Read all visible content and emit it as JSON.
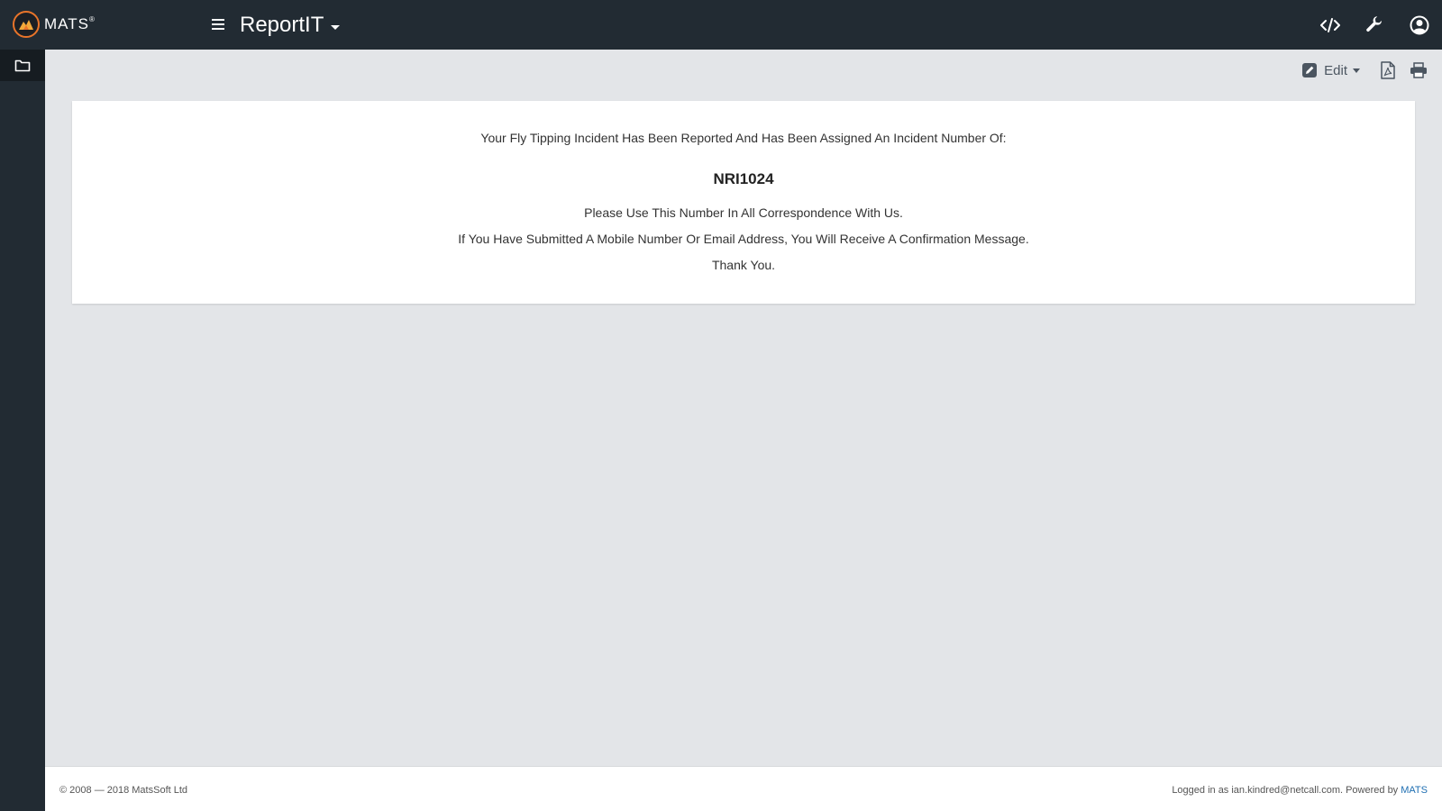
{
  "header": {
    "logo_text": "MATS",
    "logo_superscript": "®",
    "app_title": "ReportIT",
    "icons": [
      "menu-icon",
      "code-icon",
      "wrench-icon",
      "user-circle-icon"
    ]
  },
  "sidebar": {
    "items": [
      {
        "icon": "folder-icon"
      }
    ]
  },
  "toolbar": {
    "edit_label": "Edit",
    "icons": [
      "edit-icon",
      "pdf-icon",
      "print-icon"
    ]
  },
  "content": {
    "line1": "Your Fly Tipping Incident Has Been Reported And Has Been Assigned An Incident Number Of:",
    "incident_number": "NRI1024",
    "line2": "Please Use This Number In All Correspondence With Us.",
    "line3": "If You Have Submitted A Mobile Number Or Email Address, You Will Receive A Confirmation Message.",
    "line4": "Thank You."
  },
  "footer": {
    "copyright": "© 2008 — 2018 MatsSoft Ltd",
    "logged_in": "Logged in as ian.kindred@netcall.com. Powered by ",
    "powered_link": "MATS"
  },
  "colors": {
    "topbar": "#222b33",
    "sidebar_active": "#161c21",
    "page_bg": "#e3e5e8",
    "brand_orange": "#e8742a",
    "link_blue": "#1f6fb2"
  }
}
